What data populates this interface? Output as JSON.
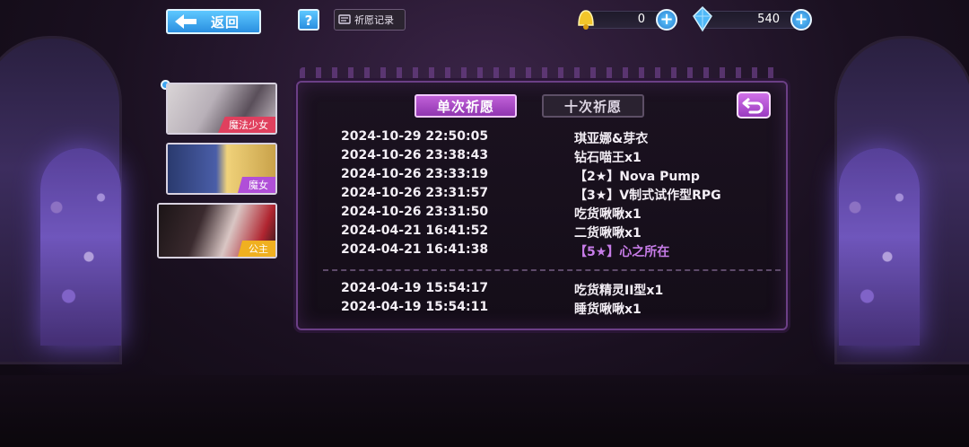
{
  "topbar": {
    "back_label": "返回",
    "help_label": "?",
    "record_label": "祈愿记录",
    "currency_gold": "0",
    "currency_gem": "540"
  },
  "side_tabs": [
    {
      "label": "魔法少女",
      "tag_color": "#e0405e",
      "selected": true
    },
    {
      "label": "魔女",
      "tag_color": "#b04fd8",
      "selected": false
    },
    {
      "label": "公主",
      "tag_color": "#f0b020",
      "selected": false
    }
  ],
  "panel": {
    "tab_single": "单次祈愿",
    "tab_ten": "十次祈愿",
    "records_group1": [
      {
        "time": "2024-10-29 22:50:05",
        "name": "琪亚娜&芽衣",
        "highlight": false
      },
      {
        "time": "2024-10-26 23:38:43",
        "name": "钻石喵王x1",
        "highlight": false
      },
      {
        "time": "2024-10-26 23:33:19",
        "name": "【2★】Nova Pump",
        "highlight": false
      },
      {
        "time": "2024-10-26 23:31:57",
        "name": "【3★】V制式试作型RPG",
        "highlight": false
      },
      {
        "time": "2024-10-26 23:31:50",
        "name": "吃货啾啾x1",
        "highlight": false
      },
      {
        "time": "2024-04-21 16:41:52",
        "name": "二货啾啾x1",
        "highlight": false
      },
      {
        "time": "2024-04-21 16:41:38",
        "name": "【5★】心之所在",
        "highlight": true
      }
    ],
    "records_group2": [
      {
        "time": "2024-04-19 15:54:17",
        "name": "吃货精灵II型x1",
        "highlight": false
      },
      {
        "time": "2024-04-19 15:54:11",
        "name": "睡货啾啾x1",
        "highlight": false
      }
    ]
  },
  "colors": {
    "accent": "#c060d8",
    "button_blue": "#2a8fe0",
    "highlight_text": "#c77ce8"
  }
}
